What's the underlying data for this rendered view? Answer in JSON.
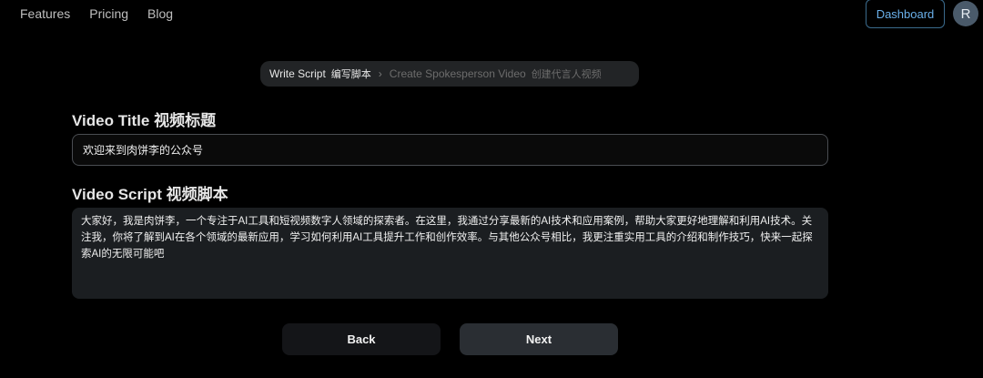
{
  "nav": {
    "links": [
      "Features",
      "Pricing",
      "Blog"
    ],
    "dashboard_label": "Dashboard",
    "avatar_initial": "R"
  },
  "breadcrumb": {
    "step1_en": "Write Script",
    "step1_zh": "编写脚本",
    "separator": "›",
    "step2_en": "Create Spokesperson Video",
    "step2_zh": "创建代言人视频"
  },
  "form": {
    "title_label": "Video Title 视频标题",
    "title_value": "欢迎来到肉饼李的公众号",
    "script_label": "Video Script 视频脚本",
    "script_value": "大家好，我是肉饼李，一个专注于AI工具和短视频数字人领域的探索者。在这里，我通过分享最新的AI技术和应用案例，帮助大家更好地理解和利用AI技术。关注我，你将了解到AI在各个领域的最新应用，学习如何利用AI工具提升工作和创作效率。与其他公众号相比，我更注重实用工具的介绍和制作技巧，快来一起探索AI的无限可能吧"
  },
  "actions": {
    "back_label": "Back",
    "next_label": "Next"
  },
  "colors": {
    "background": "#000000",
    "accent": "#6ab0ea",
    "surface": "#1b1e21"
  }
}
